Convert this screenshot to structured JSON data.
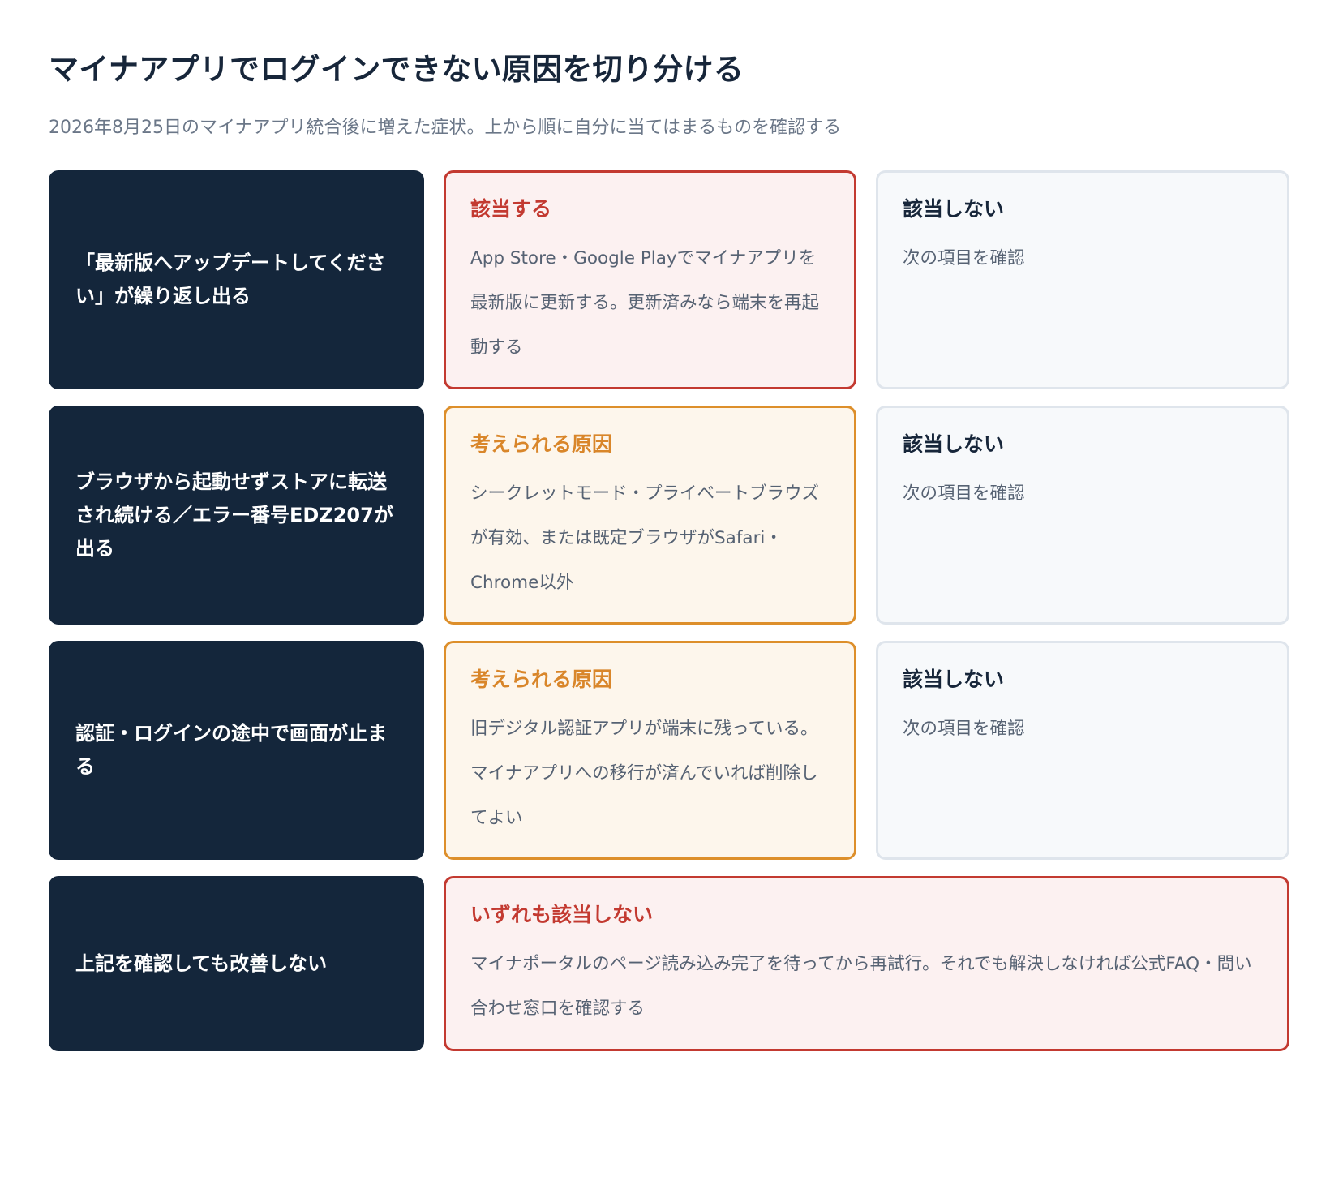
{
  "title": "マイナアプリでログインできない原因を切り分ける",
  "subtitle": "2026年8月25日のマイナアプリ統合後に増えた症状。上から順に自分に当てはまるものを確認する",
  "colors": {
    "symptom_bg": "#14263b",
    "red_accent": "#c33a31",
    "red_bg": "#fcf1f1",
    "amber_accent": "#dd8f2b",
    "amber_bg": "#fdf6ec",
    "gray_border": "#dfe5ec",
    "gray_bg": "#f7f9fb"
  },
  "rows": [
    {
      "symptom": "「最新版へアップデートしてください」が繰り返し出る",
      "yes": {
        "heading": "該当する",
        "body": "App Store・Google Playでマイナアプリを最新版に更新する。更新済みなら端末を再起動する",
        "tone": "red"
      },
      "no": {
        "heading": "該当しない",
        "body": "次の項目を確認",
        "tone": "gray"
      }
    },
    {
      "symptom": "ブラウザから起動せずストアに転送され続ける／エラー番号EDZ207が出る",
      "yes": {
        "heading": "考えられる原因",
        "body": "シークレットモード・プライベートブラウズが有効、または既定ブラウザがSafari・Chrome以外",
        "tone": "amber"
      },
      "no": {
        "heading": "該当しない",
        "body": "次の項目を確認",
        "tone": "gray"
      }
    },
    {
      "symptom": "認証・ログインの途中で画面が止まる",
      "yes": {
        "heading": "考えられる原因",
        "body": "旧デジタル認証アプリが端末に残っている。マイナアプリへの移行が済んでいれば削除してよい",
        "tone": "amber"
      },
      "no": {
        "heading": "該当しない",
        "body": "次の項目を確認",
        "tone": "gray"
      }
    },
    {
      "symptom": "上記を確認しても改善しない",
      "result": {
        "heading": "いずれも該当しない",
        "body": "マイナポータルのページ読み込み完了を待ってから再試行。それでも解決しなければ公式FAQ・問い合わせ窓口を確認する",
        "tone": "red"
      }
    }
  ]
}
